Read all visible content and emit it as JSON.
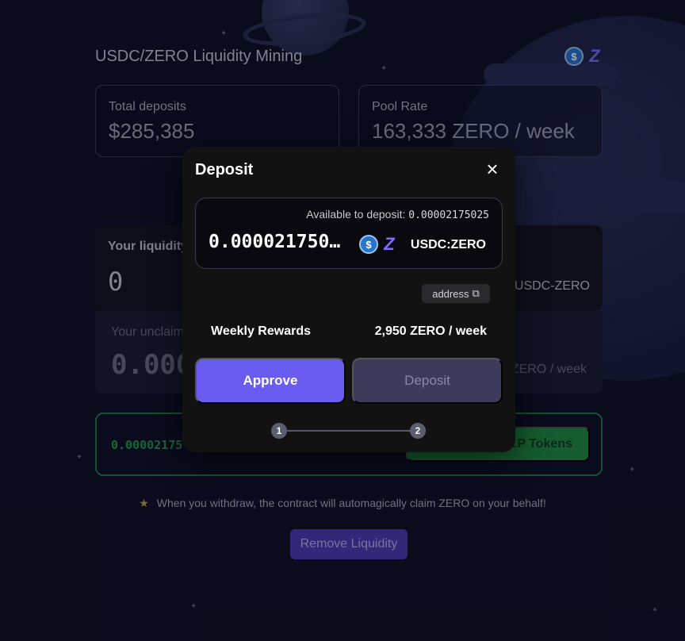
{
  "page": {
    "title": "USDC/ZERO Liquidity Mining",
    "icons": [
      "usdc-icon",
      "zero-icon"
    ]
  },
  "stats": {
    "total_deposits_label": "Total deposits",
    "total_deposits_value": "$285,385",
    "pool_rate_label": "Pool Rate",
    "pool_rate_value": "163,333 ZERO / week"
  },
  "liquidity": {
    "label": "Your liquidity",
    "value": "0",
    "lp_label": "USDC-ZERO",
    "unclaimed_label": "Your unclaimed",
    "unclaimed_value": "0.000",
    "weekly_value": "ZERO / week"
  },
  "lp_tokens": {
    "amount": "0.00002175",
    "button_label": "LP Tokens"
  },
  "note": "When you withdraw, the contract will automagically claim ZERO on your behalf!",
  "remove_label": "Remove Liquidity",
  "modal": {
    "title": "Deposit",
    "available_label": "Available to deposit:",
    "available_value": "0.00002175025",
    "amount": "0.000021750...",
    "pair": "USDC:ZERO",
    "address_label": "address",
    "weekly_rewards_label": "Weekly Rewards",
    "weekly_rewards_value": "2,950 ZERO / week",
    "approve_label": "Approve",
    "deposit_label": "Deposit",
    "step1": "1",
    "step2": "2"
  },
  "colors": {
    "accent": "#6a5cf0",
    "success": "#1e8a40",
    "background": "#0d0f22"
  }
}
